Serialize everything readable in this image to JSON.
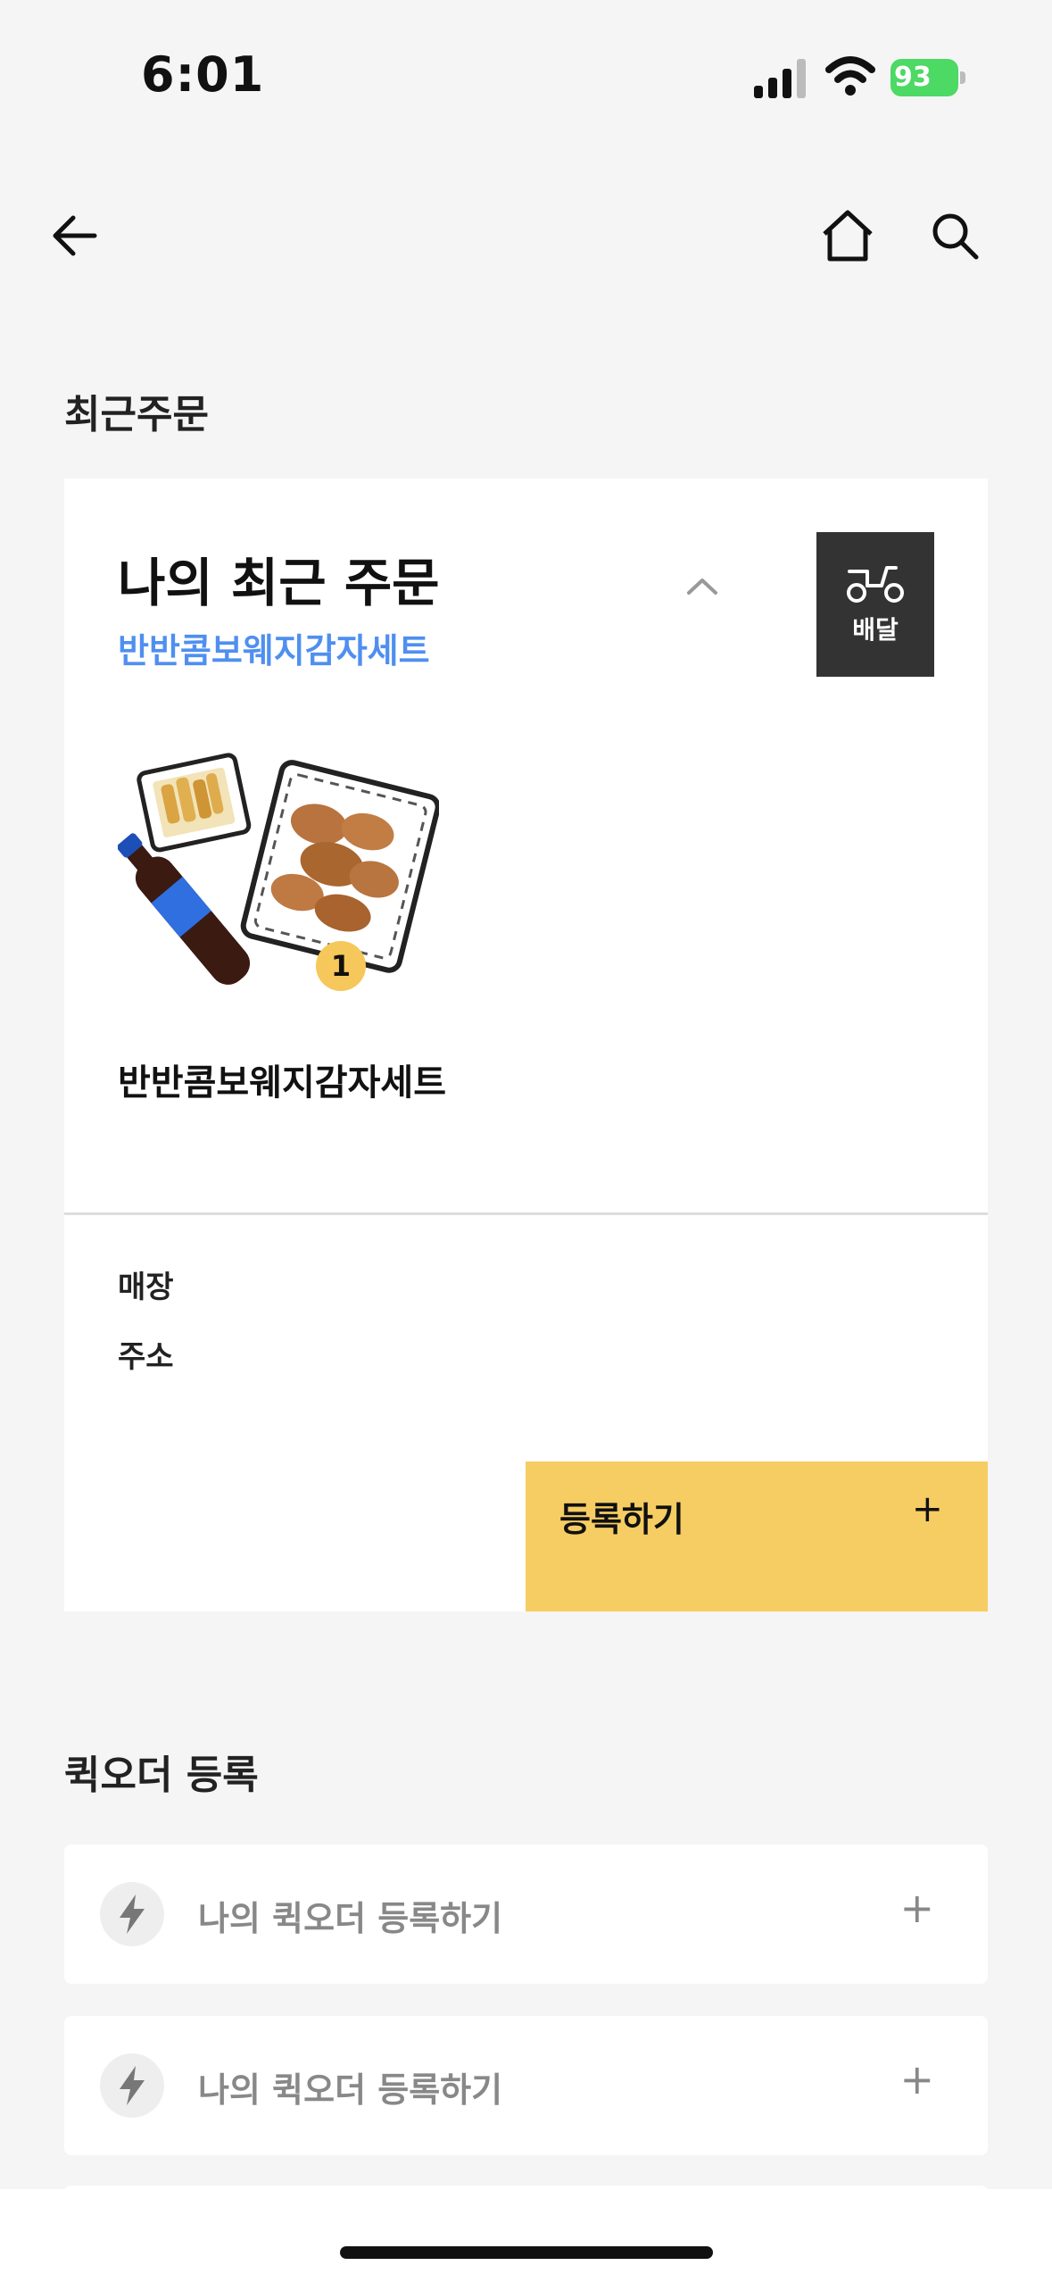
{
  "status": {
    "time": "6:01",
    "battery": "93"
  },
  "nav": {
    "back_icon": "arrow-left-icon",
    "home_icon": "home-icon",
    "search_icon": "search-icon"
  },
  "recent": {
    "section_title": "최근주문",
    "card_title": "나의 최근 주문",
    "subtitle": "반반콤보웨지감자세트",
    "delivery_label": "배달",
    "product_name": "반반콤보웨지감자세트",
    "quantity": "1",
    "store_label": "매장",
    "address_label": "주소",
    "register_label": "등록하기",
    "register_plus": "+"
  },
  "quick_order": {
    "section_title": "퀵오더 등록",
    "items": [
      {
        "label": "나의 퀵오더 등록하기",
        "plus": "+"
      },
      {
        "label": "나의 퀵오더 등록하기",
        "plus": "+"
      }
    ]
  },
  "colors": {
    "accent_yellow": "#f6cd63",
    "subtitle_blue": "#4f8ff0",
    "badge_dark": "#333333",
    "battery_green": "#4cd964"
  }
}
